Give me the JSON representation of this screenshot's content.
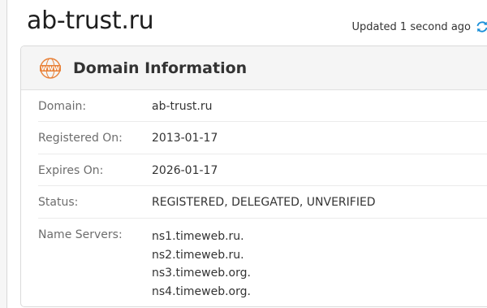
{
  "site": {
    "title": "ab-trust.ru"
  },
  "status_bar": {
    "updated_text": "Updated 1 second ago",
    "refresh_icon": "refresh-icon",
    "accent": "#1a8fd8"
  },
  "panel": {
    "title": "Domain Information",
    "icon": "www-icon",
    "icon_color": "#e8823a",
    "rows": [
      {
        "label": "Domain:",
        "value": "ab-trust.ru"
      },
      {
        "label": "Registered On:",
        "value": "2013-01-17"
      },
      {
        "label": "Expires On:",
        "value": "2026-01-17"
      },
      {
        "label": "Status:",
        "value": "REGISTERED, DELEGATED, UNVERIFIED"
      }
    ],
    "name_servers": {
      "label": "Name Servers:",
      "values": [
        "ns1.timeweb.ru.",
        "ns2.timeweb.ru.",
        "ns3.timeweb.org.",
        "ns4.timeweb.org."
      ]
    }
  }
}
